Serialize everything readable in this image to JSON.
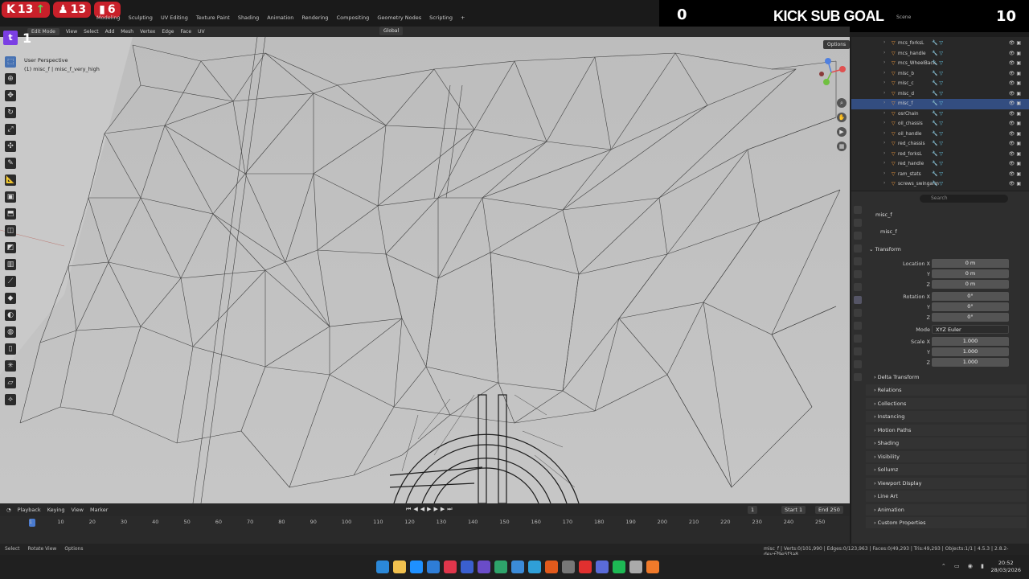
{
  "stream": {
    "badges": [
      {
        "icon": "kick-icon",
        "value": "13",
        "arrow": "↑"
      },
      {
        "icon": "follower-icon",
        "value": "13",
        "arrow": ""
      },
      {
        "icon": "bars-icon",
        "value": "6",
        "arrow": ""
      }
    ],
    "kick_left_count": "0",
    "kick_goal_title": "KICK SUB GOAL",
    "kick_goal_count": "10",
    "twitch_count": "1"
  },
  "menu": {
    "items": [
      "Modeling",
      "Sculpting",
      "UV Editing",
      "Texture Paint",
      "Shading",
      "Animation",
      "Rendering",
      "Compositing",
      "Geometry Nodes",
      "Scripting",
      "+"
    ],
    "scene_label": "Scene"
  },
  "viewport_header": {
    "mode": "Edit Mode",
    "items": [
      "View",
      "Select",
      "Add",
      "Mesh",
      "Vertex",
      "Edge",
      "Face",
      "UV"
    ],
    "orientation": "Global",
    "options": "Options",
    "xyz": "X Y Z"
  },
  "viewport": {
    "perspective": "User Perspective",
    "object_line": "(1) misc_f | misc_f_very_high"
  },
  "outliner": {
    "rows": [
      {
        "name": "mcs_forksL",
        "selected": false
      },
      {
        "name": "mcs_handle",
        "selected": false
      },
      {
        "name": "mcs_WheelBack",
        "selected": false
      },
      {
        "name": "misc_b",
        "selected": false
      },
      {
        "name": "misc_c",
        "selected": false
      },
      {
        "name": "misc_d",
        "selected": false
      },
      {
        "name": "misc_f",
        "selected": true
      },
      {
        "name": "osrChain",
        "selected": false
      },
      {
        "name": "oil_chassis",
        "selected": false
      },
      {
        "name": "oil_handle",
        "selected": false
      },
      {
        "name": "red_chassis",
        "selected": false
      },
      {
        "name": "red_forksL",
        "selected": false
      },
      {
        "name": "red_handle",
        "selected": false
      },
      {
        "name": "ram_stats",
        "selected": false
      },
      {
        "name": "screws_swingarm",
        "selected": false
      }
    ]
  },
  "properties": {
    "search_placeholder": "Search",
    "object_name": "misc_f",
    "object_name2": "misc_f",
    "transform": {
      "title": "Transform",
      "location_label": "Location X",
      "location": [
        "0 m",
        "0 m",
        "0 m"
      ],
      "rotation_label": "Rotation X",
      "rotation": [
        "0°",
        "0°",
        "0°"
      ],
      "mode_label": "Mode",
      "mode_value": "XYZ Euler",
      "scale_label": "Scale X",
      "scale": [
        "1.000",
        "1.000",
        "1.000"
      ],
      "y_label": "Y",
      "z_label": "Z"
    },
    "delta_transform": "Delta Transform",
    "panels": [
      "Relations",
      "Collections",
      "Instancing",
      "Motion Paths",
      "Shading",
      "Visibility",
      "Sollumz",
      "Viewport Display",
      "Line Art",
      "Animation",
      "Custom Properties"
    ]
  },
  "timeline": {
    "menu": [
      "Playback",
      "Keying",
      "View",
      "Marker"
    ],
    "current_frame": "1",
    "start_label": "Start",
    "start_value": "1",
    "end_label": "End",
    "end_value": "250",
    "ticks": [
      "1",
      "10",
      "20",
      "30",
      "40",
      "50",
      "60",
      "70",
      "80",
      "90",
      "100",
      "110",
      "120",
      "130",
      "140",
      "150",
      "160",
      "170",
      "180",
      "190",
      "200",
      "210",
      "220",
      "230",
      "240",
      "250"
    ]
  },
  "statusbar": {
    "left": [
      "Select",
      "Rotate View",
      "Options"
    ],
    "right": "misc_f | Verts:0/101,990 | Edges:0/123,963 | Faces:0/49,293 | Tris:49,293 | Objects:1/1 | 4.5.3 | 2.8.2-dev+f9e5f3a8"
  },
  "taskbar": {
    "time": "20:52",
    "date": "28/03/2026",
    "icon_colors": [
      "#2b88d8",
      "#f2c14e",
      "#1e90ff",
      "#2e7dd7",
      "#e0364b",
      "#3a5fcf",
      "#6a4cc8",
      "#2ea46b",
      "#3b8bd8",
      "#2f9fd8",
      "#e25a1c",
      "#777777",
      "#e0302f",
      "#5a6bd8",
      "#1db954",
      "#aaaaaa",
      "#f07a2a"
    ]
  }
}
